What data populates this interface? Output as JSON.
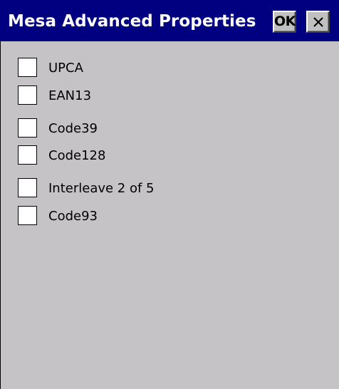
{
  "window": {
    "title": "Mesa Advanced Properties",
    "ok_label": "OK",
    "close_glyph": "close-icon"
  },
  "options": [
    {
      "label": "UPCA",
      "checked": false
    },
    {
      "label": "EAN13",
      "checked": false
    },
    {
      "label": "Code39",
      "checked": false
    },
    {
      "label": "Code128",
      "checked": false
    },
    {
      "label": "Interleave 2 of 5",
      "checked": false
    },
    {
      "label": "Code93",
      "checked": false
    }
  ],
  "colors": {
    "titlebar": "#000080",
    "title_text": "#ffffff",
    "panel": "#c6c3c6",
    "button_face": "#c0c0c0"
  }
}
